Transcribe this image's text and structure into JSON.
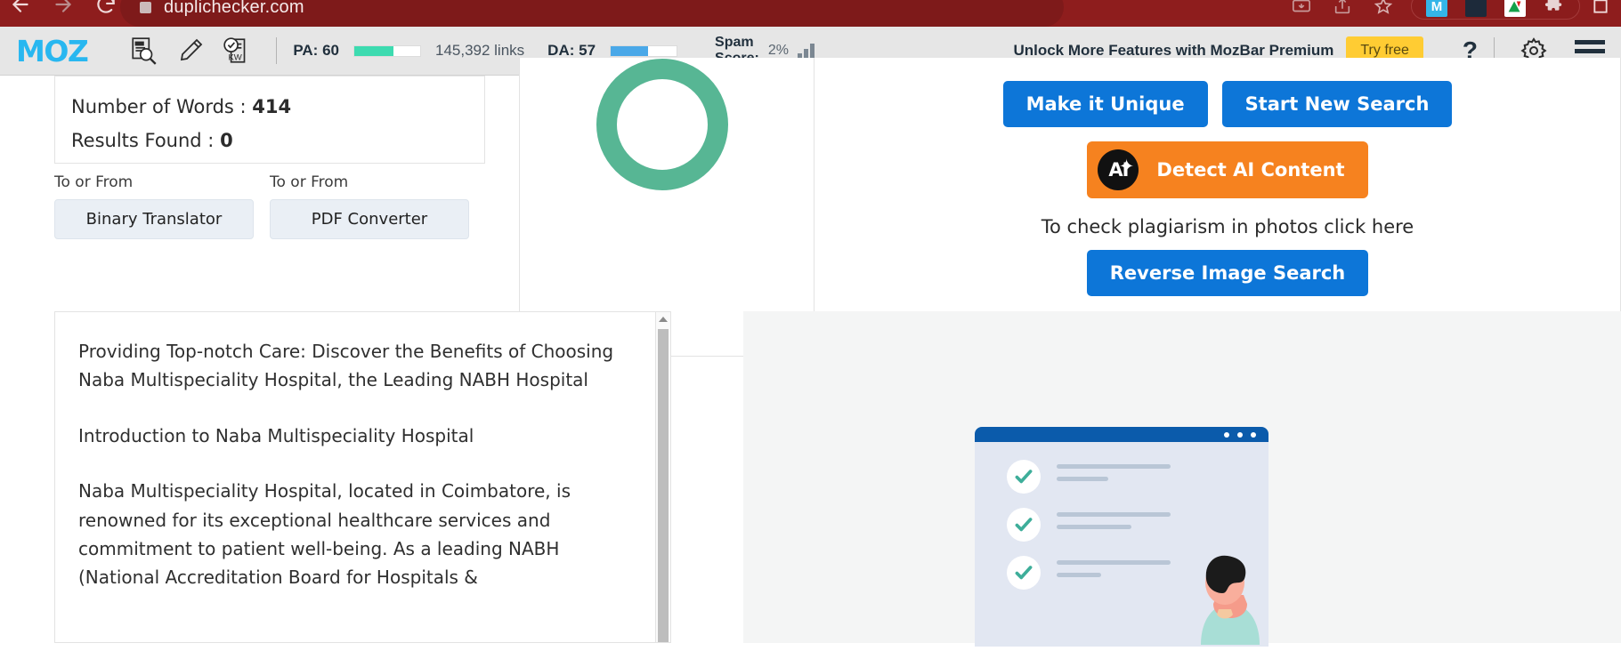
{
  "browser": {
    "url": "duplichecker.com",
    "nav_back": "back-arrow",
    "nav_forward": "forward-arrow",
    "nav_reload": "reload",
    "icons": [
      "cast-icon",
      "share-icon",
      "bookmark-star-icon",
      "moz-extension-icon",
      "dark-extension-icon",
      "grammarly-extension-icon",
      "puzzle-extensions-icon",
      "window-icon"
    ]
  },
  "mozbar": {
    "logo": "MOZ",
    "tools": [
      "page-analysis-icon",
      "highlighter-icon",
      "keyword-icon"
    ],
    "pa_label": "PA: 60",
    "pa_value": 60,
    "pa_color": "#3ddbb0",
    "links": "145,392 links",
    "da_label": "DA: 57",
    "da_value": 57,
    "da_color": "#4aa8e8",
    "spam_label_line1": "Spam",
    "spam_label_line2": "Score:",
    "spam_value": "2%",
    "promo_text": "Unlock More Features with MozBar Premium",
    "try_free": "Try free",
    "help": "?",
    "settings": "gear-icon",
    "menu": "hamburger-menu-icon"
  },
  "stats": {
    "words_label": "Number of Words : ",
    "words_value": "414",
    "results_label": "Results Found : ",
    "results_value": "0"
  },
  "tools": {
    "left_label": "To or From",
    "left_button": "Binary Translator",
    "right_label": "To or From",
    "right_button": "PDF Converter"
  },
  "result": {
    "donut_color": "#57b694",
    "make_unique": "Make it Unique",
    "start_new_search": "Start New Search",
    "detect_ai": "Detect AI Content",
    "ai_badge": "AI",
    "photo_note": "To check plagiarism in photos click here",
    "reverse_image_search": "Reverse Image Search"
  },
  "article": {
    "title": "Providing Top-notch Care: Discover the Benefits of Choosing Naba Multispeciality Hospital, the Leading NABH Hospital",
    "heading": "Introduction to Naba Multispeciality Hospital",
    "body": "Naba Multispeciality Hospital, located in Coimbatore, is renowned for its exceptional healthcare services and commitment to patient well-being. As a leading NABH (National Accreditation Board for Hospitals &"
  },
  "illustration": {
    "name": "checklist-illustration",
    "checks": 3
  }
}
